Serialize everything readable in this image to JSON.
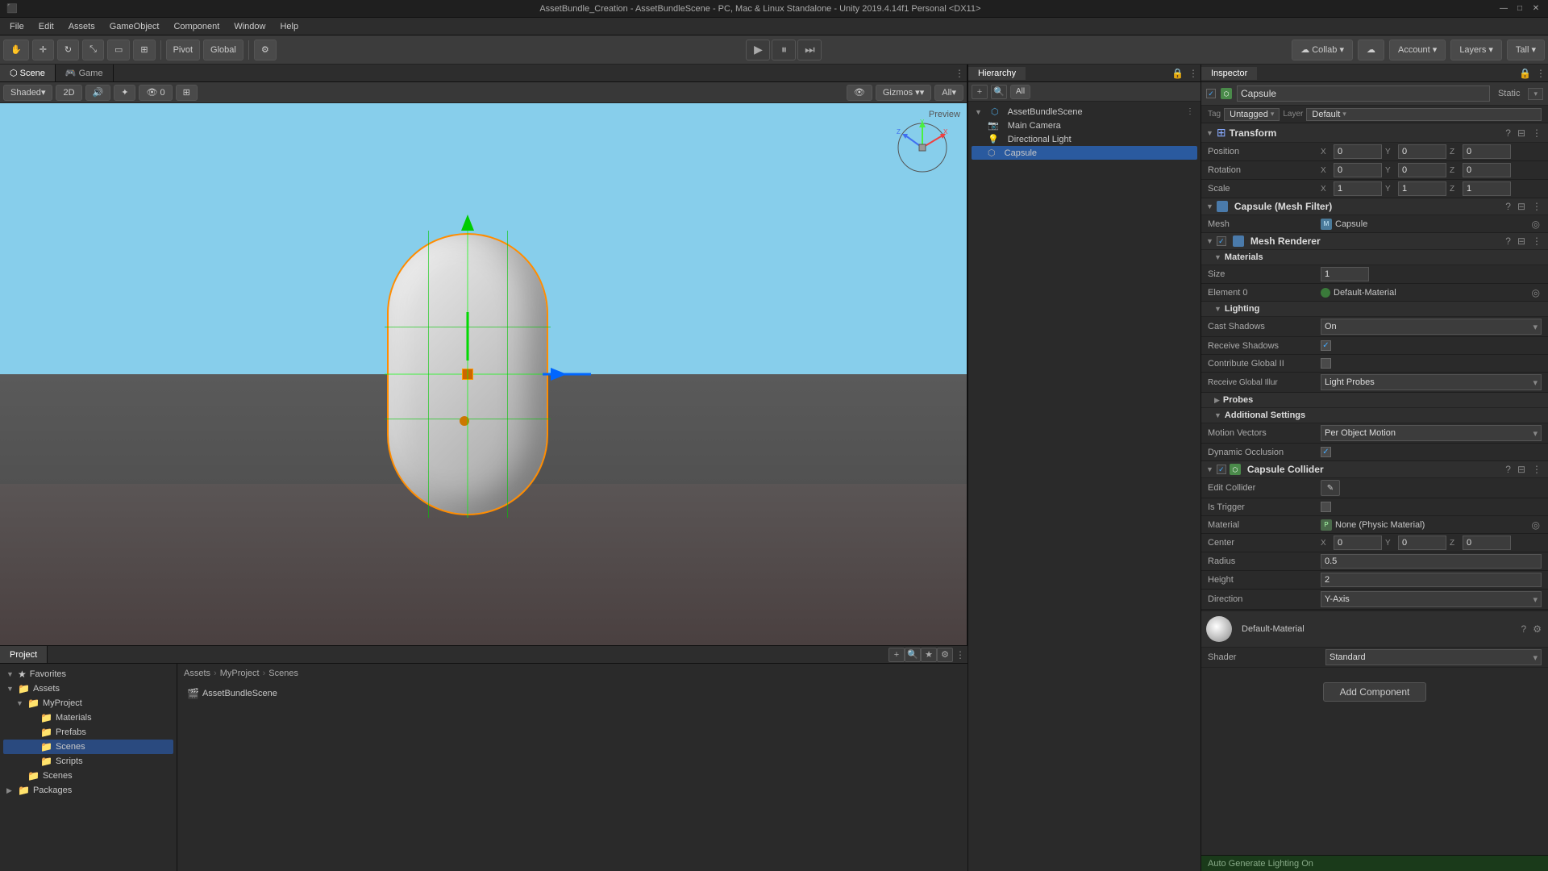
{
  "titlebar": {
    "title": "AssetBundle_Creation - AssetBundleScene - PC, Mac & Linux Standalone - Unity 2019.4.14f1 Personal <DX11>",
    "minimize": "—",
    "maximize": "□",
    "close": "✕"
  },
  "menubar": {
    "items": [
      "File",
      "Edit",
      "Assets",
      "GameObject",
      "Component",
      "Window",
      "Help"
    ]
  },
  "toolbar": {
    "pivot_label": "Pivot",
    "global_label": "Global",
    "collab_label": "Collab ▾",
    "account_label": "Account ▾",
    "layers_label": "Layers ▾",
    "layout_label": "Tall ▾",
    "play_icon": "▶",
    "pause_icon": "⏸",
    "step_icon": "⏭"
  },
  "scene": {
    "tabs": [
      "Scene",
      "Game"
    ],
    "active_tab": "Scene",
    "shading_mode": "Shaded",
    "is_2d": "2D",
    "gizmos_label": "Gizmos ▾",
    "all_label": "All",
    "preview_text": "Preview"
  },
  "hierarchy": {
    "tab_label": "Hierarchy",
    "scene_name": "AssetBundleScene",
    "items": [
      {
        "name": "AssetBundleScene",
        "type": "scene",
        "expanded": true
      },
      {
        "name": "Main Camera",
        "type": "camera",
        "parent": true
      },
      {
        "name": "Directional Light",
        "type": "light",
        "parent": true
      },
      {
        "name": "Capsule",
        "type": "object",
        "parent": true,
        "selected": true
      }
    ]
  },
  "project": {
    "tab_label": "Project",
    "breadcrumb": [
      "Assets",
      "MyProject",
      "Scenes"
    ],
    "tree": [
      {
        "name": "Favorites",
        "expanded": true
      },
      {
        "name": "Assets",
        "expanded": true
      },
      {
        "name": "MyProject",
        "expanded": true,
        "child": true
      },
      {
        "name": "Materials",
        "child2": true
      },
      {
        "name": "Prefabs",
        "child2": true
      },
      {
        "name": "Scenes",
        "child2": true,
        "selected": true
      },
      {
        "name": "Scripts",
        "child2": true
      },
      {
        "name": "Scenes",
        "child": true
      },
      {
        "name": "Packages",
        "expanded": false
      }
    ],
    "file": "AssetBundleScene"
  },
  "inspector": {
    "tab_label": "Inspector",
    "gameobject_name": "Capsule",
    "static_label": "Static",
    "tag_label": "Untagged",
    "layer_label": "Default",
    "transform": {
      "label": "Transform",
      "position": {
        "x": "0",
        "y": "0",
        "z": "0"
      },
      "rotation": {
        "x": "0",
        "y": "0",
        "z": "0"
      },
      "scale": {
        "x": "1",
        "y": "1",
        "z": "1"
      }
    },
    "mesh_filter": {
      "label": "Capsule (Mesh Filter)",
      "mesh_label": "Mesh",
      "mesh_value": "Capsule"
    },
    "mesh_renderer": {
      "label": "Mesh Renderer",
      "materials_label": "Materials",
      "size_label": "Size",
      "size_value": "1",
      "element0_label": "Element 0",
      "element0_value": "Default-Material",
      "lighting_label": "Lighting",
      "cast_shadows_label": "Cast Shadows",
      "cast_shadows_value": "On",
      "receive_shadows_label": "Receive Shadows",
      "contribute_gi_label": "Contribute Global II",
      "receive_gi_label": "Receive Global Illur",
      "receive_gi_value": "Light Probes",
      "probes_label": "Probes",
      "additional_settings_label": "Additional Settings",
      "motion_vectors_label": "Motion Vectors",
      "motion_vectors_value": "Per Object Motion",
      "dynamic_occlusion_label": "Dynamic Occlusion"
    },
    "capsule_collider": {
      "label": "Capsule Collider",
      "edit_collider_label": "Edit Collider",
      "is_trigger_label": "Is Trigger",
      "material_label": "Material",
      "material_value": "None (Physic Material)",
      "center_label": "Center",
      "center_x": "0",
      "center_y": "0",
      "center_z": "0",
      "radius_label": "Radius",
      "radius_value": "0.5",
      "height_label": "Height",
      "height_value": "2",
      "direction_label": "Direction",
      "direction_value": "Y-Axis"
    },
    "material": {
      "label": "Default-Material",
      "shader_label": "Shader",
      "shader_value": "Standard"
    },
    "add_component_label": "Add Component",
    "auto_generate_label": "Auto Generate Lighting On"
  }
}
